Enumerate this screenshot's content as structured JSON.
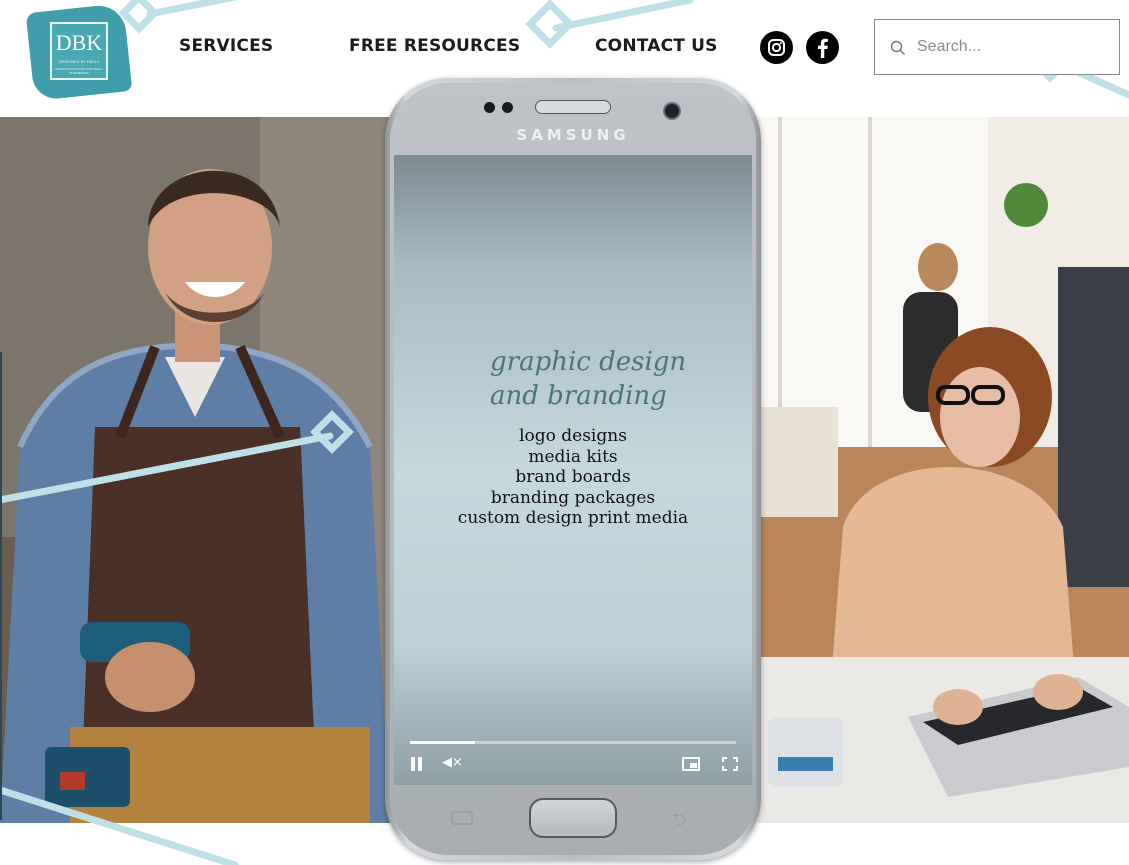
{
  "logo": {
    "mark": "DBK",
    "tagline": "DESIGNED BY KELLY",
    "subtagline": "DESIGN SOLUTIONS FOR SMALL BUSINESSES"
  },
  "nav": {
    "items": [
      {
        "label": "SERVICES"
      },
      {
        "label": "FREE RESOURCES"
      },
      {
        "label": "CONTACT US"
      }
    ]
  },
  "social": [
    "instagram-icon",
    "facebook-icon"
  ],
  "search": {
    "placeholder": "Search..."
  },
  "phone": {
    "brand": "SAMSUNG"
  },
  "video": {
    "script_line1": "graphic design",
    "script_line2": "and branding",
    "services": [
      "logo designs",
      "media kits",
      "brand boards",
      "branding packages",
      "custom design print media"
    ],
    "progress": 0.2,
    "state": "playing",
    "muted": true
  },
  "colors": {
    "accent": "#3f9ea9",
    "deco_line": "#bfe0e6",
    "script_text": "#4b7382"
  }
}
